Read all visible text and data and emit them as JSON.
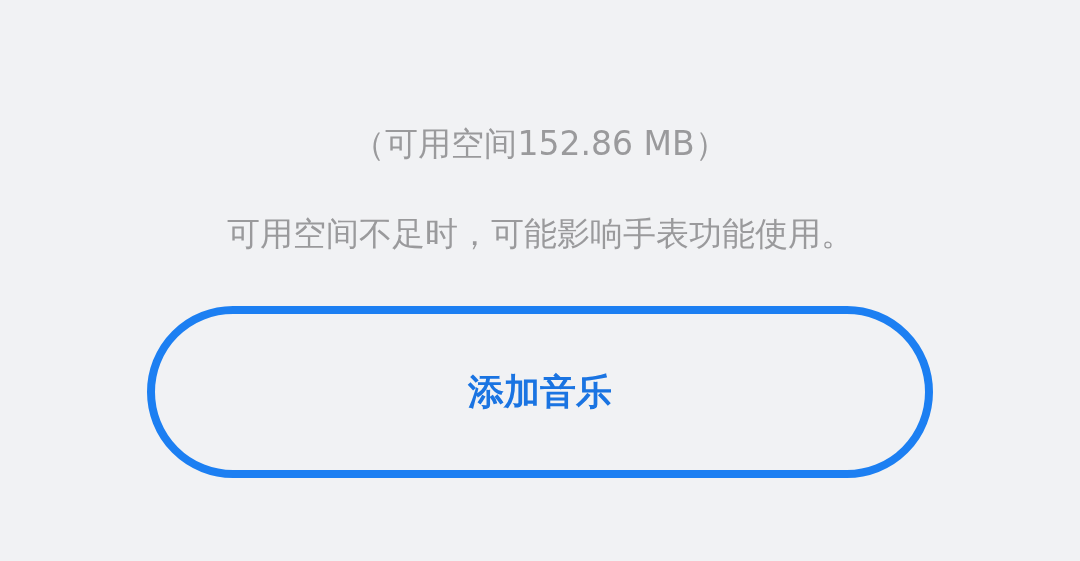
{
  "storage_info": "（可用空间152.86 MB）",
  "warning": "可用空间不足时，可能影响手表功能使用。",
  "add_button": {
    "label": "添加音乐"
  }
}
